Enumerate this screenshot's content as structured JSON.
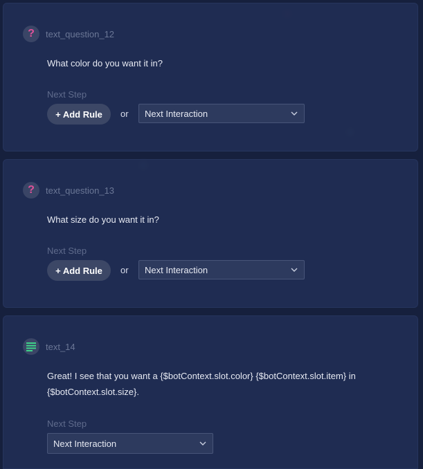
{
  "cards": [
    {
      "node_name": "text_question_12",
      "message": "What color do you want it in?",
      "next_step_label": "Next Step",
      "add_rule_label": "+ Add Rule",
      "or_label": "or",
      "next_step_value": "Next Interaction",
      "icon": "question-icon"
    },
    {
      "node_name": "text_question_13",
      "message": "What size do you want it in?",
      "next_step_label": "Next Step",
      "add_rule_label": "+ Add Rule",
      "or_label": "or",
      "next_step_value": "Next Interaction",
      "icon": "question-icon"
    },
    {
      "node_name": "text_14",
      "message_line1": "Great! I see that you want a {$botContext.slot.color} {$botContext.slot.item} in",
      "message_line2": "{$botContext.slot.size}.",
      "next_step_label": "Next Step",
      "next_step_value": "Next Interaction",
      "icon": "text-lines-icon"
    }
  ],
  "colors": {
    "background": "#16203d",
    "card": "#212e54",
    "question_icon": "#e0529a",
    "text_icon": "#3fd38a",
    "muted_text": "#6b7796"
  }
}
